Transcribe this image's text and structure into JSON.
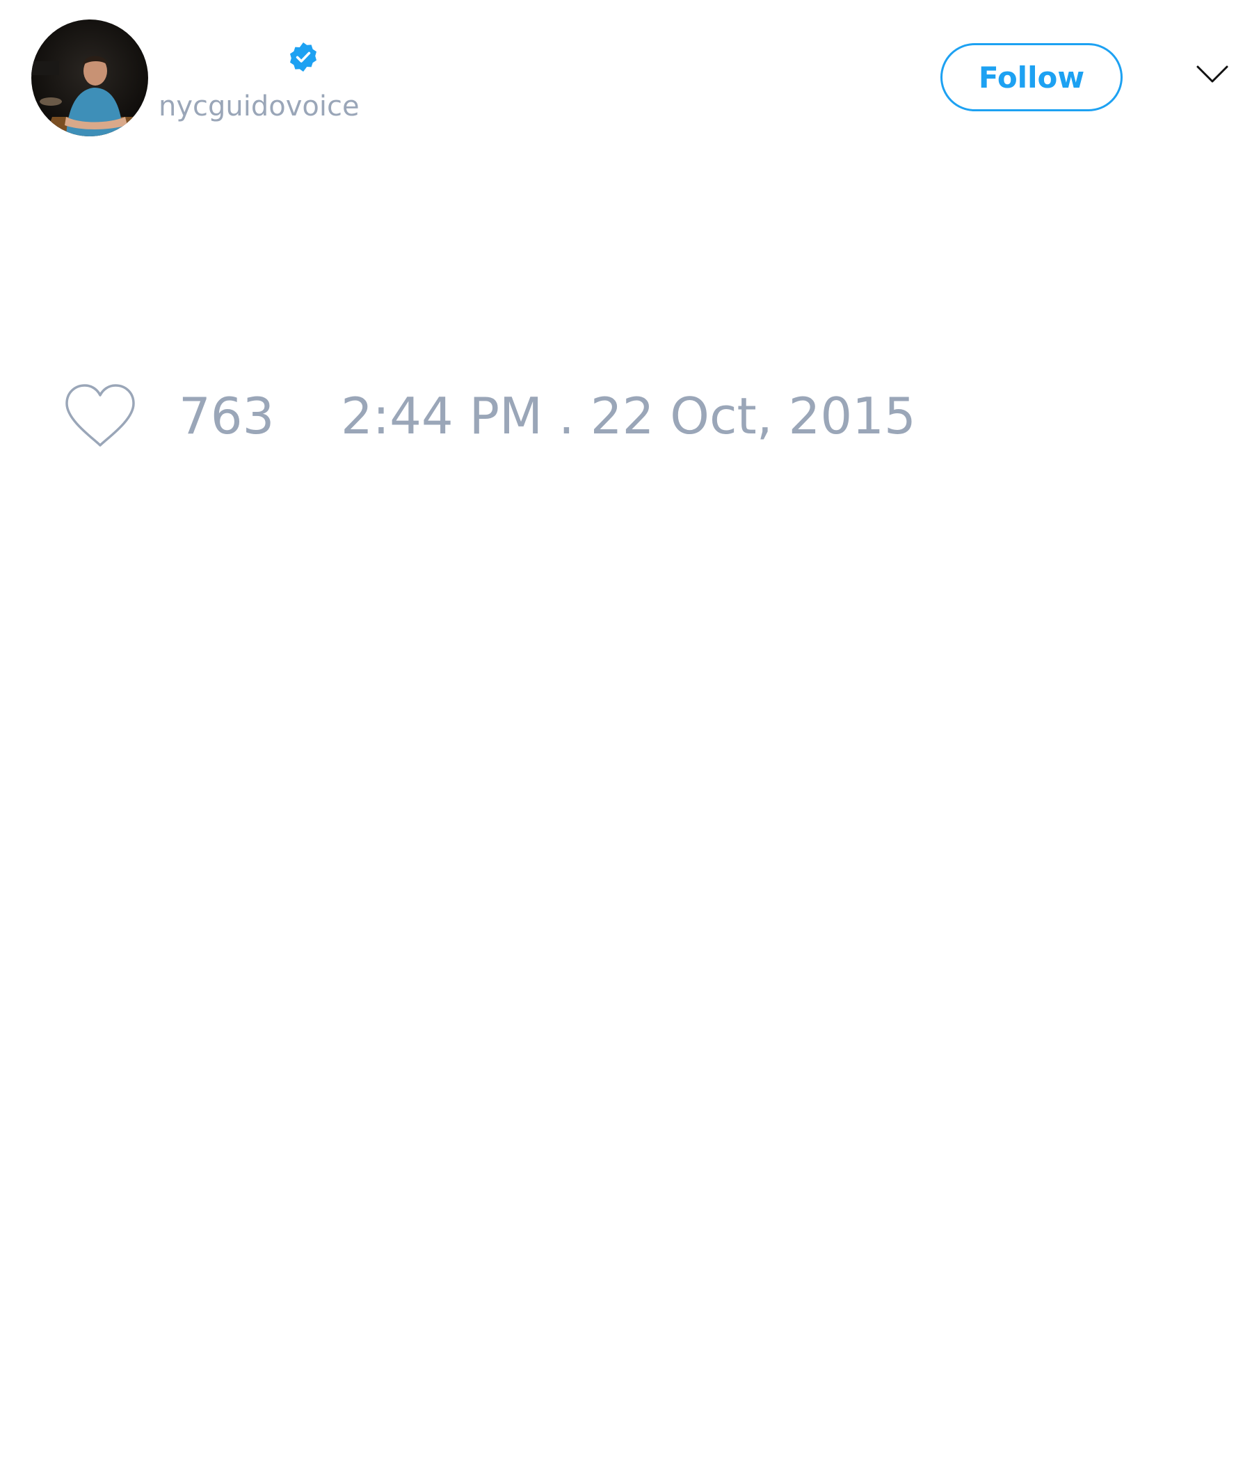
{
  "tweet": {
    "author": {
      "handle": "nycguidovoice",
      "verified": true,
      "avatar_icon": "profile-photo"
    },
    "follow_label": "Follow",
    "menu_icon": "chevron-down-icon",
    "likes": {
      "icon": "heart-icon",
      "count": "763"
    },
    "timestamp": "2:44 PM . 22 Oct, 2015"
  },
  "colors": {
    "accent": "#1da1f2",
    "muted_text": "#9aa6b8",
    "background": "#ffffff"
  }
}
